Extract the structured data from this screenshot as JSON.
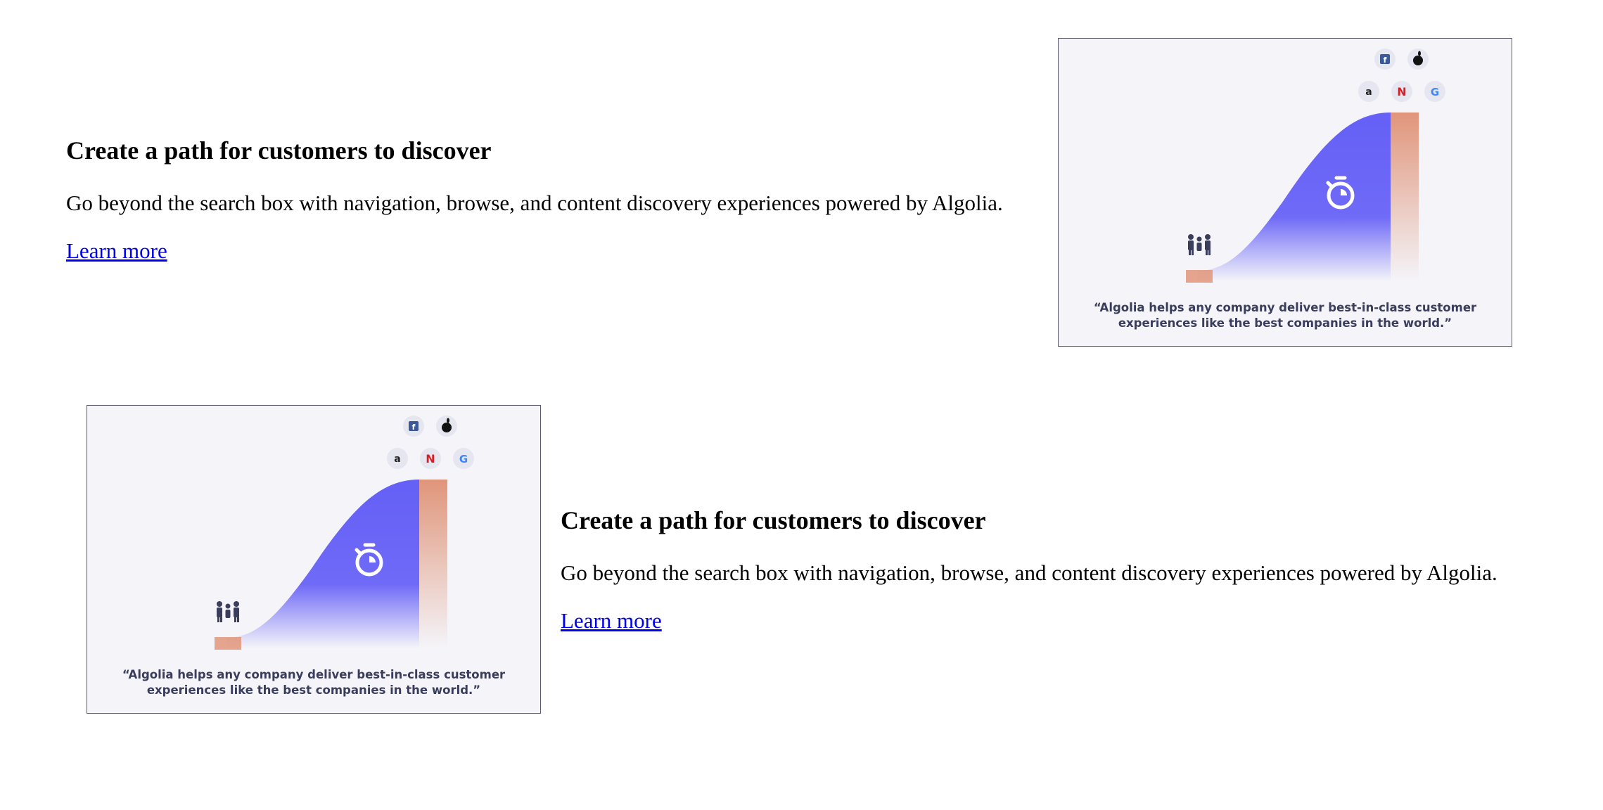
{
  "sections": [
    {
      "heading": "Create a path for customers to discover",
      "description": "Go beyond the search box with navigation, browse, and content discovery experiences powered by Algolia.",
      "link_label": "Learn more",
      "illustration": {
        "quote_line1": "“Algolia helps any company deliver best-in-class customer",
        "quote_line2": "experiences like the best companies in the world.”",
        "logos": [
          "facebook-icon",
          "apple-icon",
          "amazon-icon",
          "netflix-icon",
          "google-icon"
        ],
        "logo_letters": {
          "amazon": "a",
          "netflix": "N",
          "google": "G",
          "facebook": "f"
        }
      }
    },
    {
      "heading": "Create a path for customers to discover",
      "description": "Go beyond the search box with navigation, browse, and content discovery experiences powered by Algolia.",
      "link_label": "Learn more",
      "illustration": {
        "quote_line1": "“Algolia helps any company deliver best-in-class customer",
        "quote_line2": "experiences like the best companies in the world.”",
        "logos": [
          "facebook-icon",
          "apple-icon",
          "amazon-icon",
          "netflix-icon",
          "google-icon"
        ],
        "logo_letters": {
          "amazon": "a",
          "netflix": "N",
          "google": "G",
          "facebook": "f"
        }
      }
    }
  ],
  "colors": {
    "curve": "#6560f6",
    "bar": "#e0957a",
    "link": "#0000ee",
    "quote_text": "#3a3d5c",
    "card_bg": "#f4f4f9"
  }
}
